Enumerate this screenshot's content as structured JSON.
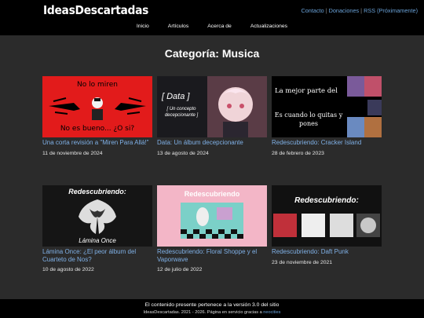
{
  "site": {
    "logo": "IdeasDescartadas",
    "top_links": [
      "Contacto",
      "Donaciones",
      "RSS (Próximamente)"
    ]
  },
  "nav": [
    "Inicio",
    "Artículos",
    "Acerca de",
    "Actualizaciones"
  ],
  "page_title": "Categoría: Musica",
  "cards": [
    {
      "title": "Una corta revisión a \"Miren Para Allá!\"",
      "date": "11 de noviembre de 2024",
      "thumb": {
        "top": "No lo miren",
        "bottom": "No es bueno... ¿O si?"
      }
    },
    {
      "title": "Data: Un álbum decepcionante",
      "date": "13 de agosto de 2024",
      "thumb": {
        "big": "[ Data ]",
        "small": "[ Un concepto decepcionante ]"
      }
    },
    {
      "title": "Redescubriendo: Cracker Island",
      "date": "28 de febrero de 2023",
      "thumb": {
        "top": "La mejor parte del",
        "bottom": "Es cuando lo quitas y pones"
      }
    },
    {
      "title": "Lámina Once: ¿El peor álbum del Cuarteto de Nos?",
      "date": "10 de agosto de 2022",
      "thumb": {
        "top": "Redescubriendo:",
        "bottom": "Lámina Once"
      }
    },
    {
      "title": "Redescubriendo: Floral Shoppe y el Vaporwave",
      "date": "12 de julio de 2022",
      "thumb": {
        "top": "Redescubriendo"
      }
    },
    {
      "title": "Redescubriendo: Daft Punk",
      "date": "23 de noviembre de 2021",
      "thumb": {
        "top": "Redescubriendo:"
      }
    }
  ],
  "footer": {
    "line1": "El contenido presente pertenece a la versión 3.0 del sitio",
    "line2": "IdeasDescartadas. 2021 - 2026. Página en servicio gracias a",
    "line2_link": "neocities"
  },
  "colors": {
    "link": "#6aa2d8",
    "card_title": "#7fb0e6",
    "page_bg": "#2b2b2b",
    "bar_bg": "#000000"
  }
}
